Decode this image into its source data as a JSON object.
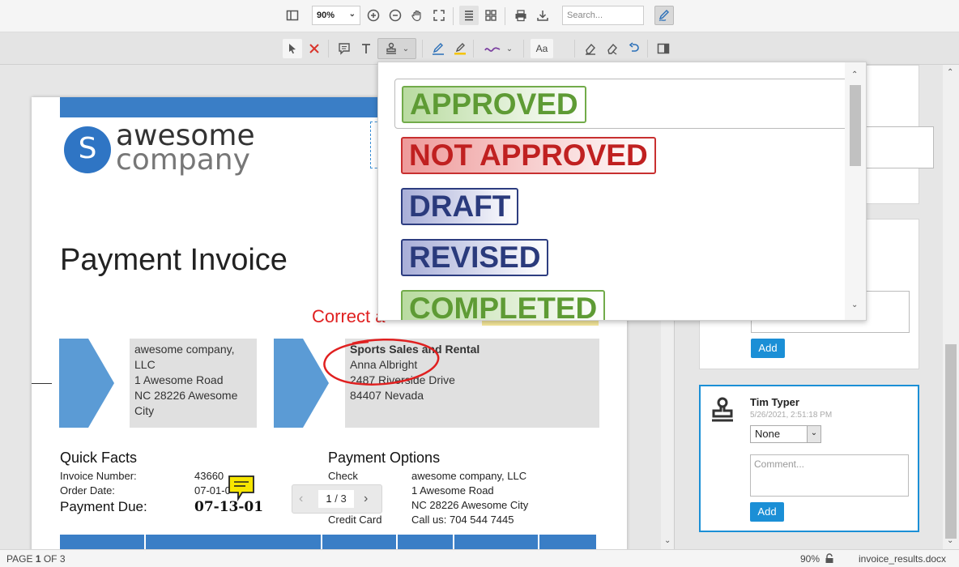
{
  "toolbar_top": {
    "zoom_value": "90%",
    "search_placeholder": "Search..."
  },
  "toolbar_annot": {
    "font_button_label": "Aa"
  },
  "stamp_dropdown": {
    "items": [
      {
        "label": "APPROVED",
        "color": "#5e9b34"
      },
      {
        "label": "NOT APPROVED",
        "color": "#c02020"
      },
      {
        "label": "DRAFT",
        "color": "#2a3a7c"
      },
      {
        "label": "REVISED",
        "color": "#2a3a7c"
      },
      {
        "label": "COMPLETED",
        "color": "#5e9b34"
      }
    ]
  },
  "document": {
    "logo_letter": "S",
    "logo_line1": "awesome",
    "logo_line2": "company",
    "title": "Payment Invoice",
    "annotation_text": "Correct a",
    "seller": {
      "name": "awesome company, LLC",
      "street": "1 Awesome Road",
      "city": "NC 28226 Awesome City"
    },
    "buyer": {
      "company": "Sports Sales and Rental",
      "contact": "Anna Albright",
      "street": "2487 Riverside Drive",
      "city": "84407 Nevada"
    },
    "quick_facts": {
      "heading": "Quick Facts",
      "invoice_number_label": "Invoice Number:",
      "invoice_number": "43660",
      "order_date_label": "Order Date:",
      "order_date": "07-01-0",
      "payment_due_label": "Payment Due:",
      "payment_due": "07-13-01"
    },
    "payment_options": {
      "heading": "Payment Options",
      "check_label": "Check",
      "credit_label": "Credit Card",
      "name": "awesome company, LLC",
      "street": "1 Awesome Road",
      "city": "NC 28226 Awesome City",
      "call": "Call us: 704 544 7445"
    }
  },
  "pager": {
    "current": "1",
    "separator": "/",
    "total": "3"
  },
  "comments_panel": {
    "card3": {
      "author": "Tim Typer",
      "timestamp": "5/26/2021, 2:51:18 PM",
      "status": "None",
      "comment_placeholder": "Comment...",
      "add_label": "Add"
    },
    "card2": {
      "add_label": "Add"
    }
  },
  "statusbar": {
    "page_prefix": "PAGE",
    "page_number": "1",
    "page_suffix": "OF 3",
    "zoom": "90%",
    "filename": "invoice_results.docx"
  }
}
